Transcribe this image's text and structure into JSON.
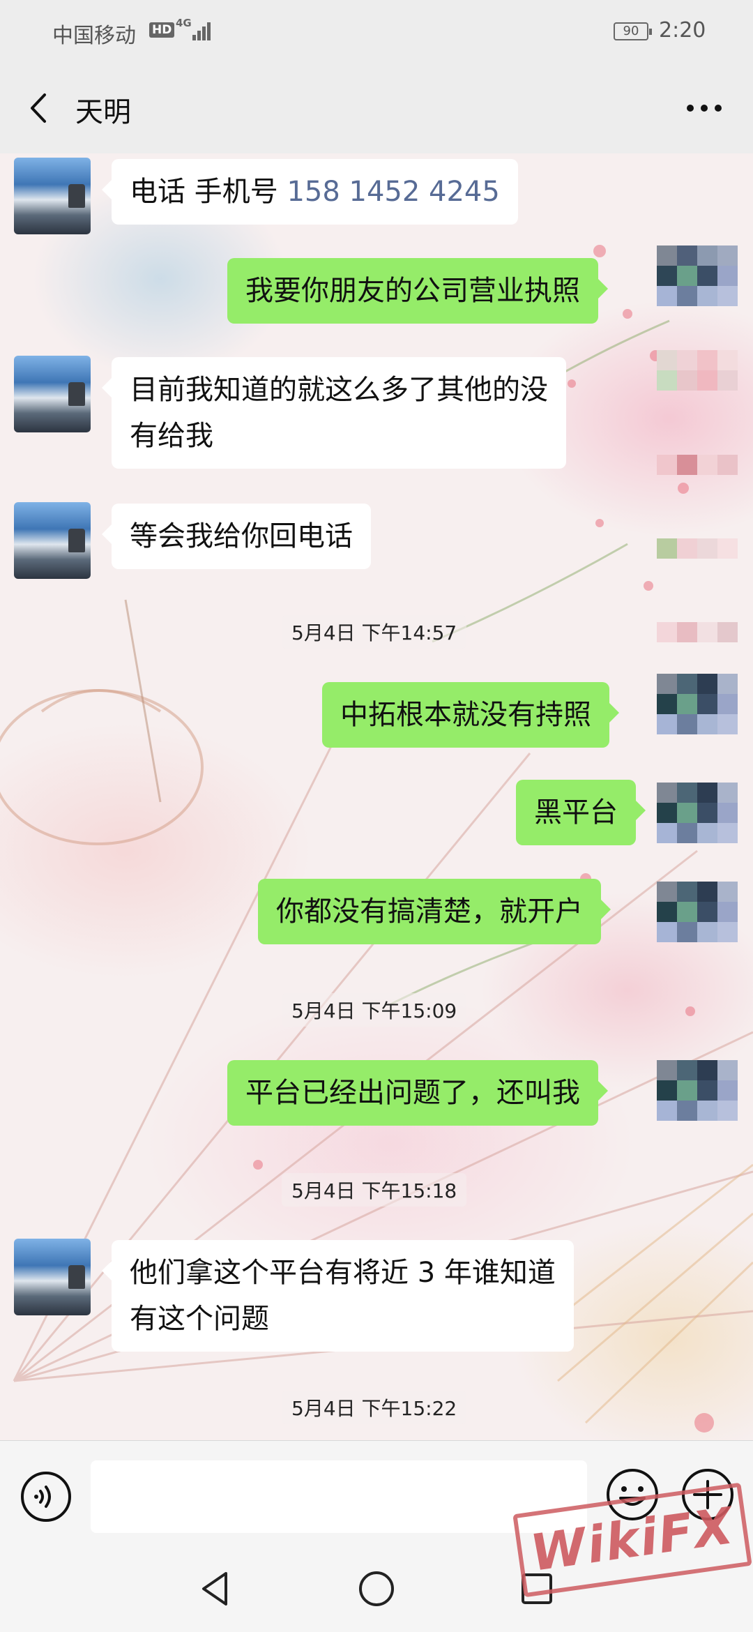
{
  "status_bar": {
    "carrier": "中国移动",
    "hd_badge": "HD",
    "network": "4G",
    "battery": "90",
    "time": "2:20"
  },
  "header": {
    "title": "天明"
  },
  "messages": [
    {
      "type": "in",
      "text_prefix": "电话 手机号 ",
      "phone": "158 1452 4245"
    },
    {
      "type": "out",
      "text": "我要你朋友的公司营业执照"
    },
    {
      "type": "in",
      "text_line1": "目前我知道的就这么多了其他的没",
      "text_line2": "有给我"
    },
    {
      "type": "in",
      "text": "等会我给你回电话"
    },
    {
      "type": "time",
      "text": "5月4日 下午14:57"
    },
    {
      "type": "out",
      "text": "中拓根本就没有持照"
    },
    {
      "type": "out",
      "text": "黑平台"
    },
    {
      "type": "out",
      "text": "你都没有搞清楚，就开户"
    },
    {
      "type": "time",
      "text": "5月4日 下午15:09"
    },
    {
      "type": "out",
      "text": "平台已经出问题了，还叫我"
    },
    {
      "type": "time",
      "text": "5月4日 下午15:18"
    },
    {
      "type": "in",
      "text_line1": "他们拿这个平台有将近 3 年谁知道",
      "text_line2": "有这个问题"
    },
    {
      "type": "time",
      "text": "5月4日 下午15:22"
    }
  ],
  "input_bar": {
    "placeholder": ""
  },
  "watermark": "WikiFX",
  "colors": {
    "outgoing_bubble": "#95ec69",
    "incoming_bubble": "#ffffff",
    "link": "#576b95",
    "header_bg": "#ededed"
  }
}
